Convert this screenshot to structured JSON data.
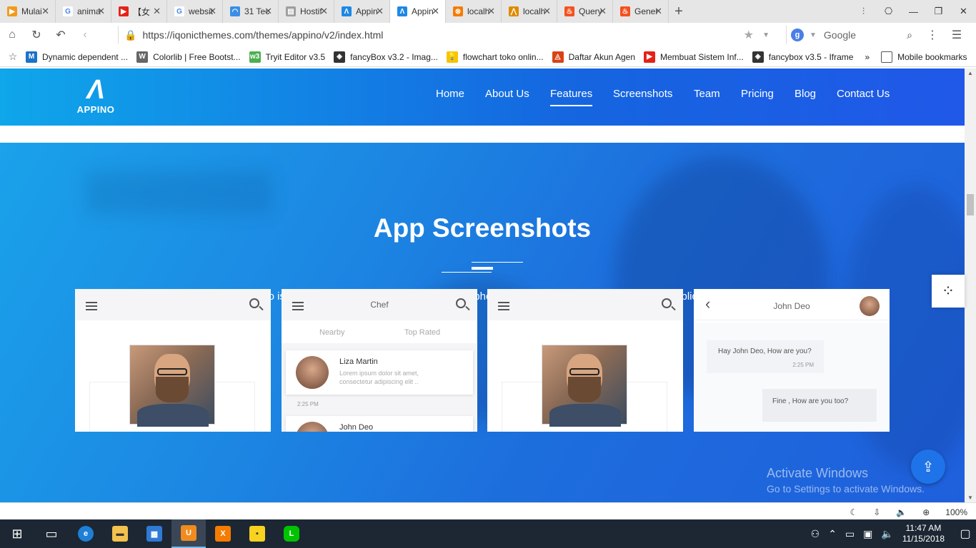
{
  "browser": {
    "tabs": [
      {
        "label": "Mulai",
        "icon_color": "#f29a1d",
        "icon": "play-icon",
        "active": false
      },
      {
        "label": "anima",
        "icon_color": "#ffffff",
        "icon": "google-icon",
        "active": false
      },
      {
        "label": "【女",
        "icon_color": "#e62117",
        "icon": "youtube-icon",
        "active": false
      },
      {
        "label": "websit",
        "icon_color": "#ffffff",
        "icon": "google-icon",
        "active": false
      },
      {
        "label": "31 Tec",
        "icon_color": "#3a8ee6",
        "icon": "loading-icon",
        "active": false
      },
      {
        "label": "Hostif",
        "icon_color": "#9e9e9e",
        "icon": "page-icon",
        "active": false
      },
      {
        "label": "Appin",
        "icon_color": "#1e88e5",
        "icon": "appino-icon",
        "active": false
      },
      {
        "label": "Appin",
        "icon_color": "#1e88e5",
        "icon": "appino-icon",
        "active": true
      },
      {
        "label": "localh",
        "icon_color": "#f57c00",
        "icon": "xampp-icon",
        "active": false
      },
      {
        "label": "localh",
        "icon_color": "#e08a00",
        "icon": "pma-icon",
        "active": false
      },
      {
        "label": "Query",
        "icon_color": "#f4511e",
        "icon": "fire-icon",
        "active": false
      },
      {
        "label": "Gener",
        "icon_color": "#f4511e",
        "icon": "fire-icon",
        "active": false
      }
    ],
    "url": "https://iqonicthemes.com/themes/appino/v2/index.html",
    "search_engine": "Google",
    "bookmarks": [
      {
        "label": "Dynamic dependent ...",
        "icon_color": "#1a73c9",
        "icon": "m-icon"
      },
      {
        "label": "Colorlib | Free Bootst...",
        "icon_color": "#666666",
        "icon": "wordpress-icon"
      },
      {
        "label": "Tryit Editor v3.5",
        "icon_color": "#4caf50",
        "icon": "w3-icon"
      },
      {
        "label": "fancyBox v3.2 - Imag...",
        "icon_color": "#333333",
        "icon": "codepen-icon"
      },
      {
        "label": "flowchart toko onlin...",
        "icon_color": "#f9c400",
        "icon": "bulb-icon"
      },
      {
        "label": "Daftar Akun Agen",
        "icon_color": "#d84315",
        "icon": "agen-icon"
      },
      {
        "label": "Membuat Sistem Inf...",
        "icon_color": "#e62117",
        "icon": "youtube-icon"
      },
      {
        "label": "fancybox v3.5 - Iframe",
        "icon_color": "#333333",
        "icon": "codepen-icon"
      }
    ],
    "bookmarks_more": "»",
    "mobile_bookmarks": "Mobile bookmarks",
    "zoom": "100%"
  },
  "site": {
    "logo_text": "APPINO",
    "menu": [
      "Home",
      "About Us",
      "Features",
      "Screenshots",
      "Team",
      "Pricing",
      "Blog",
      "Contact Us"
    ],
    "active_menu": "Features",
    "section_title": "App Screenshots",
    "section_text": "Appino is here with its best screenshot, from this photo gallery you can get idea about this application.",
    "phone2": {
      "title": "Chef",
      "tab1": "Nearby",
      "tab2": "Top Rated",
      "name": "Liza Martin",
      "line1": "Lorem ipsum dolor sit amet,",
      "line2": "consectetur adipiscing elit ..",
      "time": "2:25 PM",
      "next_name": "John Deo"
    },
    "phone4": {
      "title": "John Deo",
      "msg1": "Hay John Deo, How are you?",
      "msg1_time": "2:25 PM",
      "msg2": "Fine , How are you too?"
    }
  },
  "watermark": {
    "line1": "Activate Windows",
    "line2": "Go to Settings to activate Windows."
  },
  "taskbar": {
    "time": "11:47 AM",
    "date": "11/15/2018"
  },
  "colors": {
    "header_start": "#0fa6ea",
    "header_end": "#2058e8",
    "accent": "#1e73e8"
  }
}
